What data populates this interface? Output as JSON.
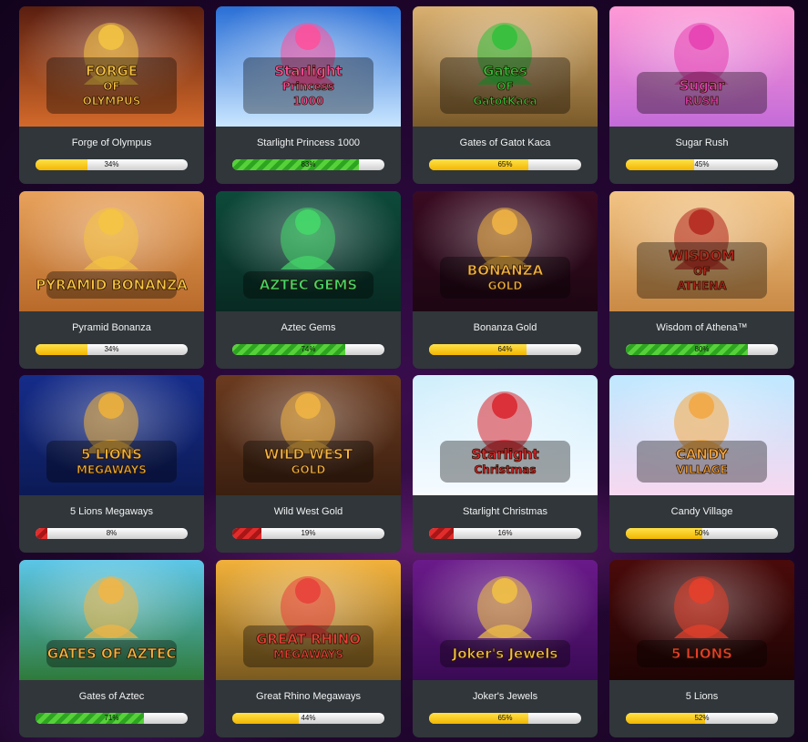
{
  "games": [
    {
      "title": "Forge of Olympus",
      "percent": 34,
      "logo": [
        "FORGE",
        "OF",
        "OLYMPUS"
      ],
      "sky": "#5a1e10",
      "ground": "#d2692a",
      "accent": "#f5c542",
      "icon": "hammer-hero-icon"
    },
    {
      "title": "Starlight Princess 1000",
      "percent": 83,
      "logo": [
        "Starlight",
        "Princess",
        "1000"
      ],
      "sky": "#2a6fd6",
      "ground": "#c9e6ff",
      "accent": "#ff4f9a",
      "icon": "princess-icon"
    },
    {
      "title": "Gates of Gatot Kaca",
      "percent": 65,
      "logo": [
        "Gates",
        "OF",
        "GatotKaca"
      ],
      "sky": "#d9b070",
      "ground": "#7a5a2a",
      "accent": "#2fbf3a",
      "icon": "warrior-icon"
    },
    {
      "title": "Sugar Rush",
      "percent": 45,
      "logo": [
        "Sugar",
        "RUSH",
        ""
      ],
      "sky": "#ff9ad6",
      "ground": "#c46bd8",
      "accent": "#e53fb0",
      "icon": "gummy-bear-icon"
    },
    {
      "title": "Pyramid Bonanza",
      "percent": 34,
      "logo": [
        "PYRAMID BONANZA",
        "",
        ""
      ],
      "sky": "#e8a25c",
      "ground": "#b86a2a",
      "accent": "#f5c542",
      "icon": "scarab-wings-icon"
    },
    {
      "title": "Aztec Gems",
      "percent": 74,
      "logo": [
        "AZTEC GEMS",
        "",
        ""
      ],
      "sky": "#0d4a3a",
      "ground": "#082a22",
      "accent": "#44d96a",
      "icon": "aztec-mask-icon"
    },
    {
      "title": "Bonanza Gold",
      "percent": 64,
      "logo": [
        "BONANZA",
        "GOLD",
        ""
      ],
      "sky": "#3a0b22",
      "ground": "#1d0612",
      "accent": "#f2b543",
      "icon": "gems-icon"
    },
    {
      "title": "Wisdom of Athena™",
      "percent": 80,
      "logo": [
        "WISDOM",
        "OF",
        "ATHENA"
      ],
      "sky": "#f2c485",
      "ground": "#c98a45",
      "accent": "#b3261e",
      "icon": "athena-icon"
    },
    {
      "title": "5 Lions Megaways",
      "percent": 8,
      "logo": [
        "5 LIONS",
        "MEGAWAYS",
        ""
      ],
      "sky": "#152c8a",
      "ground": "#0c1a55",
      "accent": "#f0b23a",
      "icon": "lion-statue-icon"
    },
    {
      "title": "Wild West Gold",
      "percent": 19,
      "logo": [
        "WILD WEST",
        "GOLD",
        ""
      ],
      "sky": "#6b3b1f",
      "ground": "#3b1f10",
      "accent": "#f2b543",
      "icon": "cowboys-icon"
    },
    {
      "title": "Starlight Christmas",
      "percent": 16,
      "logo": [
        "Starlight",
        "Christmas",
        ""
      ],
      "sky": "#cfeefc",
      "ground": "#f6fbff",
      "accent": "#d9232b",
      "icon": "santa-girl-icon"
    },
    {
      "title": "Candy Village",
      "percent": 50,
      "logo": [
        "CANDY",
        "VILLAGE",
        ""
      ],
      "sky": "#bfe8ff",
      "ground": "#f7d8f0",
      "accent": "#f2a640",
      "icon": "candy-icon"
    },
    {
      "title": "Gates of Aztec",
      "percent": 71,
      "logo": [
        "GATES OF AZTEC",
        "",
        ""
      ],
      "sky": "#5cc6e8",
      "ground": "#2f7a3a",
      "accent": "#f2b543",
      "icon": "aztec-warrior-icon"
    },
    {
      "title": "Great Rhino Megaways",
      "percent": 44,
      "logo": [
        "GREAT RHINO",
        "MEGAWAYS",
        ""
      ],
      "sky": "#f2b13a",
      "ground": "#7a5a20",
      "accent": "#e8403a",
      "icon": "rhino-icon"
    },
    {
      "title": "Joker's Jewels",
      "percent": 65,
      "logo": [
        "Joker's Jewels",
        "",
        ""
      ],
      "sky": "#6a1a8a",
      "ground": "#3a0a55",
      "accent": "#f2c243",
      "icon": "joker-icon"
    },
    {
      "title": "5 Lions",
      "percent": 52,
      "logo": [
        "5 LIONS",
        "",
        ""
      ],
      "sky": "#4a0a0a",
      "ground": "#1f0404",
      "accent": "#e8402a",
      "icon": "lion-icon"
    }
  ]
}
